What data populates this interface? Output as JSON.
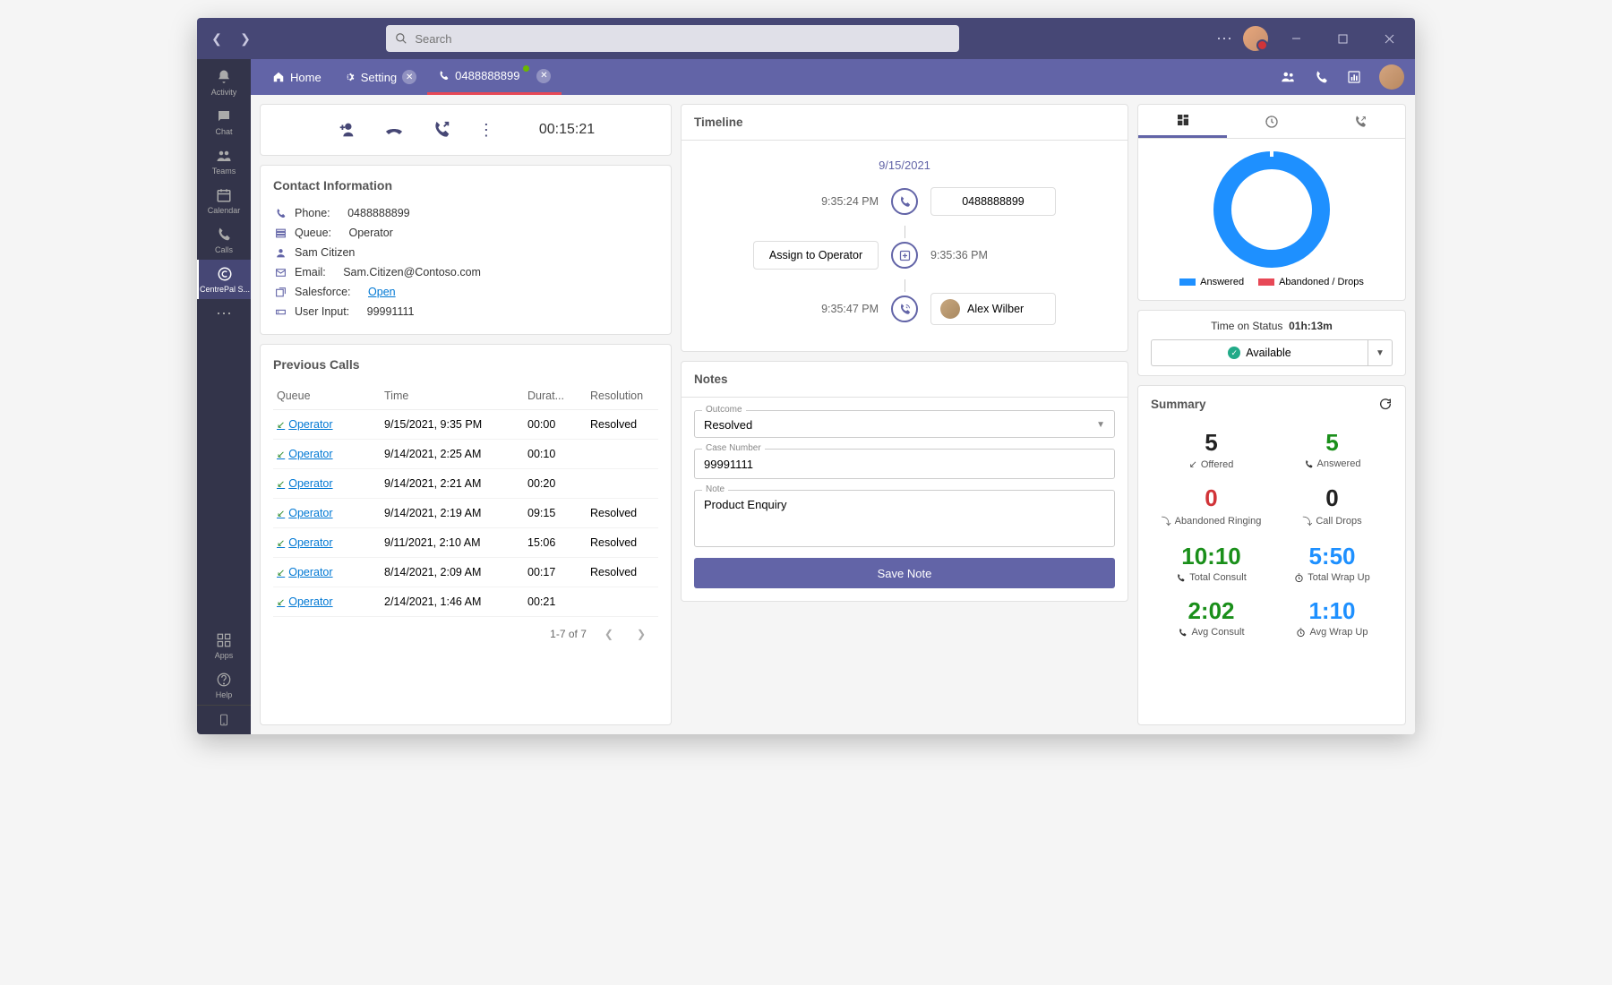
{
  "titlebar": {
    "search_placeholder": "Search"
  },
  "sidebar": {
    "items": [
      {
        "label": "Activity"
      },
      {
        "label": "Chat"
      },
      {
        "label": "Teams"
      },
      {
        "label": "Calendar"
      },
      {
        "label": "Calls"
      },
      {
        "label": "CentrePal S..."
      }
    ],
    "apps_label": "Apps",
    "help_label": "Help"
  },
  "tabs": {
    "home": "Home",
    "setting": "Setting",
    "active": "0488888899"
  },
  "call": {
    "timer": "00:15:21"
  },
  "contact": {
    "title": "Contact Information",
    "phone_label": "Phone:",
    "phone": "0488888899",
    "queue_label": "Queue:",
    "queue": "Operator",
    "name": "Sam Citizen",
    "email_label": "Email:",
    "email": "Sam.Citizen@Contoso.com",
    "salesforce_label": "Salesforce:",
    "salesforce_link": "Open",
    "userinput_label": "User Input:",
    "userinput": "99991111"
  },
  "previous": {
    "title": "Previous Calls",
    "headers": {
      "queue": "Queue",
      "time": "Time",
      "duration": "Durat...",
      "resolution": "Resolution"
    },
    "rows": [
      {
        "queue": "Operator",
        "time": "9/15/2021, 9:35 PM",
        "duration": "00:00",
        "resolution": "Resolved"
      },
      {
        "queue": "Operator",
        "time": "9/14/2021, 2:25 AM",
        "duration": "00:10",
        "resolution": ""
      },
      {
        "queue": "Operator",
        "time": "9/14/2021, 2:21 AM",
        "duration": "00:20",
        "resolution": ""
      },
      {
        "queue": "Operator",
        "time": "9/14/2021, 2:19 AM",
        "duration": "09:15",
        "resolution": "Resolved"
      },
      {
        "queue": "Operator",
        "time": "9/11/2021, 2:10 AM",
        "duration": "15:06",
        "resolution": "Resolved"
      },
      {
        "queue": "Operator",
        "time": "8/14/2021, 2:09 AM",
        "duration": "00:17",
        "resolution": "Resolved"
      },
      {
        "queue": "Operator",
        "time": "2/14/2021, 1:46 AM",
        "duration": "00:21",
        "resolution": ""
      }
    ],
    "pager": "1-7 of 7"
  },
  "timeline": {
    "title": "Timeline",
    "date": "9/15/2021",
    "events": [
      {
        "time": "9:35:24 PM",
        "caller": "0488888899"
      },
      {
        "time": "9:35:36 PM",
        "action": "Assign to Operator"
      },
      {
        "time": "9:35:47 PM",
        "agent": "Alex Wilber"
      }
    ]
  },
  "notes": {
    "title": "Notes",
    "outcome_label": "Outcome",
    "outcome": "Resolved",
    "case_label": "Case Number",
    "case": "99991111",
    "note_label": "Note",
    "note": "Product Enquiry",
    "save": "Save Note"
  },
  "status": {
    "legend_answered": "Answered",
    "legend_abandoned": "Abandoned / Drops",
    "time_label": "Time on Status",
    "time_value": "01h:13m",
    "state": "Available"
  },
  "summary": {
    "title": "Summary",
    "stats": [
      {
        "value": "5",
        "label": "Offered",
        "color": "c-black",
        "icon": "↙"
      },
      {
        "value": "5",
        "label": "Answered",
        "color": "c-green",
        "icon": "phone"
      },
      {
        "value": "0",
        "label": "Abandoned Ringing",
        "color": "c-red",
        "icon": "↯"
      },
      {
        "value": "0",
        "label": "Call Drops",
        "color": "c-black",
        "icon": "↯"
      },
      {
        "value": "10:10",
        "label": "Total Consult",
        "color": "c-green",
        "icon": "phone"
      },
      {
        "value": "5:50",
        "label": "Total Wrap Up",
        "color": "c-blue",
        "icon": "⏱"
      },
      {
        "value": "2:02",
        "label": "Avg Consult",
        "color": "c-green",
        "icon": "phone"
      },
      {
        "value": "1:10",
        "label": "Avg Wrap Up",
        "color": "c-blue",
        "icon": "⏱"
      }
    ]
  },
  "chart_data": {
    "type": "pie",
    "title": "",
    "series": [
      {
        "name": "Answered",
        "value": 5,
        "color": "#1e90ff"
      },
      {
        "name": "Abandoned / Drops",
        "value": 0,
        "color": "#e74856"
      }
    ]
  }
}
